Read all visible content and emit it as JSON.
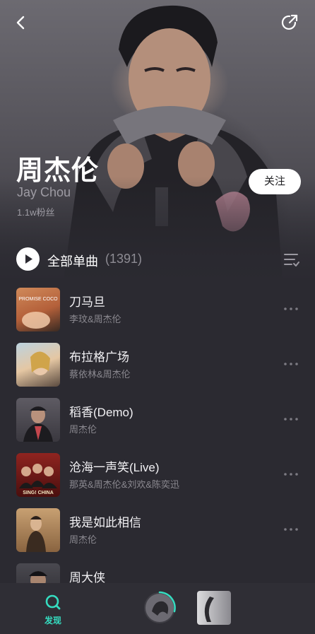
{
  "artist": {
    "name": "周杰伦",
    "name_en": "Jay Chou",
    "fans": "1.1w粉丝",
    "follow_label": "关注"
  },
  "play_all": {
    "label": "全部单曲",
    "count": "(1391)"
  },
  "songs": [
    {
      "title": "刀马旦",
      "artist": "李玟&周杰伦",
      "cover_text": "PROMISE COCO",
      "cover_color": "#c9825a"
    },
    {
      "title": "布拉格广场",
      "artist": "蔡依林&周杰伦",
      "cover_color": "#9bb7c9"
    },
    {
      "title": "稻香(Demo)",
      "artist": "周杰伦",
      "cover_color": "#4a4750"
    },
    {
      "title": "沧海一声笑(Live)",
      "artist": "那英&周杰伦&刘欢&陈奕迅",
      "cover_text": "SING! CHINA",
      "cover_color": "#7a1b18"
    },
    {
      "title": "我是如此相信",
      "artist": "周杰伦",
      "cover_color": "#b68a5e"
    },
    {
      "title": "周大侠",
      "artist": "",
      "cover_color": "#3a3a3f"
    }
  ],
  "nav": {
    "discover_label": "发现",
    "accent": "#35dcc0"
  },
  "icons": [
    "back-icon",
    "share-icon",
    "play-icon",
    "sort-icon",
    "more-icon",
    "discover-icon"
  ]
}
